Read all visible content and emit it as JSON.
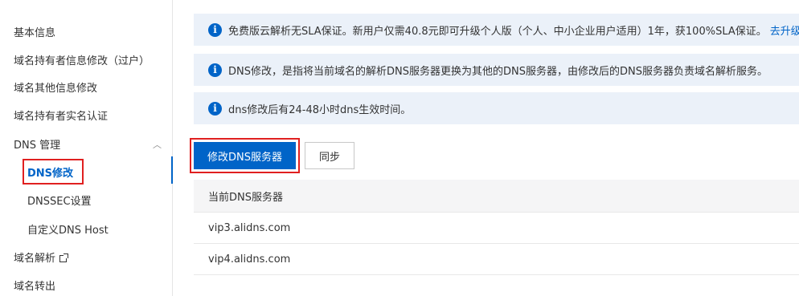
{
  "sidebar": {
    "items": [
      {
        "label": "基本信息"
      },
      {
        "label": "域名持有者信息修改（过户）"
      },
      {
        "label": "域名其他信息修改"
      },
      {
        "label": "域名持有者实名认证"
      },
      {
        "label": "DNS 管理"
      },
      {
        "label": "DNS修改"
      },
      {
        "label": "DNSSEC设置"
      },
      {
        "label": "自定义DNS Host"
      },
      {
        "label": "域名解析"
      },
      {
        "label": "域名转出"
      }
    ]
  },
  "notices": [
    {
      "text": "免费版云解析无SLA保证。新用户仅需40.8元即可升级个人版（个人、中小企业用户适用）1年，获100%SLA保证。",
      "link": "去升级"
    },
    {
      "text": "DNS修改，是指将当前域名的解析DNS服务器更换为其他的DNS服务器，由修改后的DNS服务器负责域名解析服务。"
    },
    {
      "text": "dns修改后有24-48小时dns生效时间。"
    }
  ],
  "actions": {
    "modify_dns": "修改DNS服务器",
    "sync": "同步"
  },
  "table": {
    "header": "当前DNS服务器",
    "rows": [
      "vip3.alidns.com",
      "vip4.alidns.com"
    ]
  }
}
